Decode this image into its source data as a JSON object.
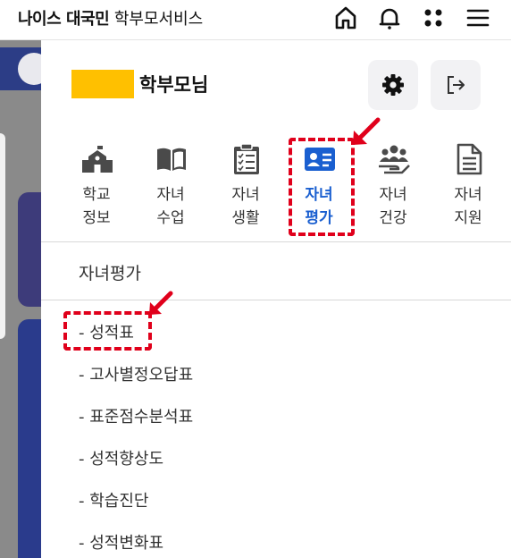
{
  "header": {
    "brand_bold": "나이스 대국민",
    "brand_rest": "학부모서비스",
    "icons": [
      "home-icon",
      "bell-icon",
      "apps-grid-icon",
      "hamburger-menu-icon"
    ]
  },
  "panel": {
    "user_name": "학부모님",
    "settings_icon": "gear-icon",
    "logout_icon": "logout-icon",
    "menu": [
      {
        "line1": "학교",
        "line2": "정보",
        "icon": "school-icon",
        "active": false
      },
      {
        "line1": "자녀",
        "line2": "수업",
        "icon": "book-icon",
        "active": false
      },
      {
        "line1": "자녀",
        "line2": "생활",
        "icon": "clipboard-icon",
        "active": false
      },
      {
        "line1": "자녀",
        "line2": "평가",
        "icon": "id-card-icon",
        "active": true
      },
      {
        "line1": "자녀",
        "line2": "건강",
        "icon": "people-hand-icon",
        "active": false
      },
      {
        "line1": "자녀",
        "line2": "지원",
        "icon": "document-icon",
        "active": false
      }
    ],
    "section_title": "자녀평가",
    "sub_items": [
      "- 성적표",
      "- 고사별정오답표",
      "- 표준점수분석표",
      "- 성적향상도",
      "- 학습진단",
      "- 성적변화표"
    ]
  },
  "colors": {
    "accent": "#1a5fd0",
    "highlight": "#e0001b",
    "name_mask": "#ffc000"
  }
}
